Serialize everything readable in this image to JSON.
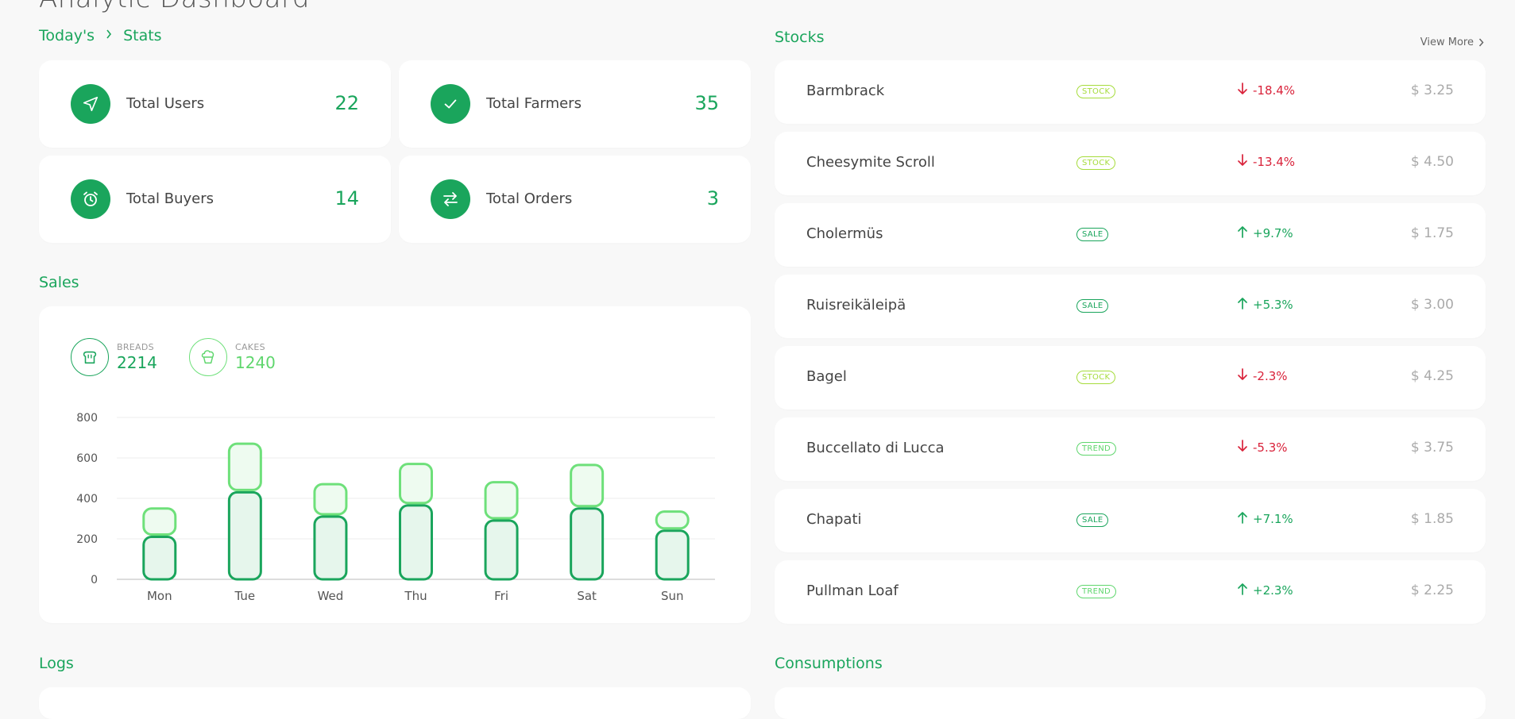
{
  "page": {
    "title": "Analytic Dashboard"
  },
  "stats": {
    "breadcrumb_today": "Today's",
    "breadcrumb_stats": "Stats",
    "cards": [
      {
        "label": "Total Users",
        "value": "22",
        "icon": "send-icon"
      },
      {
        "label": "Total Farmers",
        "value": "35",
        "icon": "check-icon"
      },
      {
        "label": "Total Buyers",
        "value": "14",
        "icon": "alarm-clock-icon"
      },
      {
        "label": "Total Orders",
        "value": "3",
        "icon": "swap-arrows-icon"
      }
    ]
  },
  "sales": {
    "title": "Sales",
    "legend": [
      {
        "caption": "BREADS",
        "value": "2214",
        "icon": "bread-icon",
        "color": "#1aa55c"
      },
      {
        "caption": "CAKES",
        "value": "1240",
        "icon": "cupcake-icon",
        "color": "#6ee07a"
      }
    ]
  },
  "chart_data": {
    "type": "bar",
    "stacked": true,
    "categories": [
      "Mon",
      "Tue",
      "Wed",
      "Thu",
      "Fri",
      "Sat",
      "Sun"
    ],
    "series": [
      {
        "name": "BREADS",
        "values": [
          210,
          430,
          310,
          365,
          290,
          350,
          240
        ],
        "color": "#1aa55c"
      },
      {
        "name": "CAKES",
        "values": [
          140,
          240,
          160,
          205,
          190,
          215,
          95
        ],
        "color": "#6ee07a"
      }
    ],
    "ylim": [
      0,
      800
    ],
    "yticks": [
      0,
      200,
      400,
      600,
      800
    ],
    "grid": true
  },
  "stocks": {
    "title": "Stocks",
    "view_more": "View More",
    "rows": [
      {
        "name": "Barmbrack",
        "badge": "STOCK",
        "badge_color": "#a6dc3c",
        "change": "-18.4%",
        "direction": "down",
        "price": "$ 3.25"
      },
      {
        "name": "Cheesymite Scroll",
        "badge": "STOCK",
        "badge_color": "#a6dc3c",
        "change": "-13.4%",
        "direction": "down",
        "price": "$ 4.50"
      },
      {
        "name": "Cholermüs",
        "badge": "SALE",
        "badge_color": "#1aa55c",
        "change": "+9.7%",
        "direction": "up",
        "price": "$ 1.75"
      },
      {
        "name": "Ruisreikäleipä",
        "badge": "SALE",
        "badge_color": "#1aa55c",
        "change": "+5.3%",
        "direction": "up",
        "price": "$ 3.00"
      },
      {
        "name": "Bagel",
        "badge": "STOCK",
        "badge_color": "#a6dc3c",
        "change": "-2.3%",
        "direction": "down",
        "price": "$ 4.25"
      },
      {
        "name": "Buccellato di Lucca",
        "badge": "TREND",
        "badge_color": "#5fd66d",
        "change": "-5.3%",
        "direction": "down",
        "price": "$ 3.75"
      },
      {
        "name": "Chapati",
        "badge": "SALE",
        "badge_color": "#1aa55c",
        "change": "+7.1%",
        "direction": "up",
        "price": "$ 1.85"
      },
      {
        "name": "Pullman Loaf",
        "badge": "TREND",
        "badge_color": "#5fd66d",
        "change": "+2.3%",
        "direction": "up",
        "price": "$ 2.25"
      }
    ]
  },
  "logs": {
    "title": "Logs"
  },
  "consumptions": {
    "title": "Consumptions"
  },
  "colors": {
    "accent": "#1aa55c",
    "accent_light": "#6ee07a",
    "down": "#d9223a",
    "up": "#1aa55c"
  }
}
